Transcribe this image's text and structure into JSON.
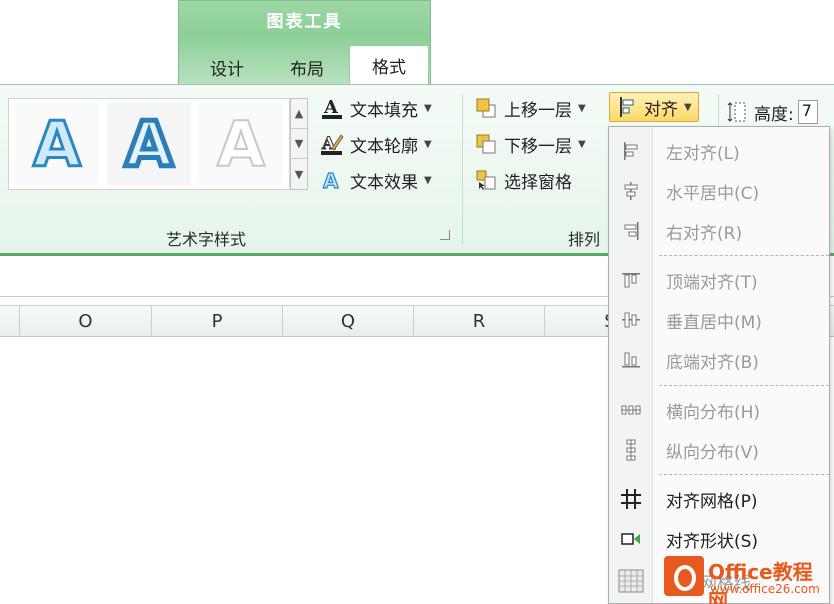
{
  "contextual_group": {
    "title": "图表工具",
    "tabs": [
      "设计",
      "布局",
      "格式"
    ],
    "active_tab": "格式"
  },
  "wordart": {
    "gallery": [
      "A",
      "A",
      "A"
    ],
    "text_fill": "文本填充",
    "text_outline": "文本轮廓",
    "text_effect": "文本效果",
    "group_label": "艺术字样式"
  },
  "arrange": {
    "bring_forward": "上移一层",
    "send_backward": "下移一层",
    "selection_pane": "选择窗格",
    "align": "对齐",
    "group_label": "排列",
    "size_label": "高度:",
    "size_value": "7"
  },
  "columns": [
    "O",
    "P",
    "Q",
    "R",
    "S"
  ],
  "align_menu": {
    "items": [
      {
        "label": "左对齐(L)",
        "icon": "align-left-icon",
        "enabled": false
      },
      {
        "label": "水平居中(C)",
        "icon": "align-center-icon",
        "enabled": false
      },
      {
        "label": "右对齐(R)",
        "icon": "align-right-icon",
        "enabled": false
      },
      {
        "label": "顶端对齐(T)",
        "icon": "align-top-icon",
        "enabled": false
      },
      {
        "label": "垂直居中(M)",
        "icon": "align-middle-icon",
        "enabled": false
      },
      {
        "label": "底端对齐(B)",
        "icon": "align-bottom-icon",
        "enabled": false
      },
      {
        "label": "横向分布(H)",
        "icon": "distribute-horizontal-icon",
        "enabled": false
      },
      {
        "label": "纵向分布(V)",
        "icon": "distribute-vertical-icon",
        "enabled": false
      },
      {
        "label": "对齐网格(P)",
        "icon": "snap-to-grid-icon",
        "enabled": true
      },
      {
        "label": "对齐形状(S)",
        "icon": "snap-to-shape-icon",
        "enabled": true
      },
      {
        "label": "查看网格线",
        "icon": "view-gridlines-icon",
        "enabled": false
      }
    ]
  },
  "watermark": {
    "brand": "Office教程网",
    "url": "www.office26.com"
  },
  "colors": {
    "accent_green": "#58a86a",
    "align_highlight": "#ffd966",
    "watermark_orange": "#e8591f"
  }
}
